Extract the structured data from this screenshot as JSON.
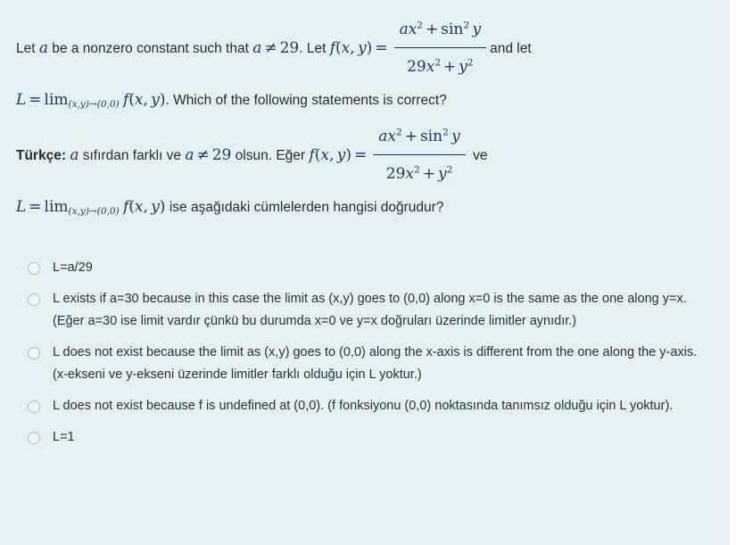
{
  "question": {
    "english": {
      "line1_pre": "Let ",
      "var_a": "a",
      "line1_mid": " be a nonzero constant such that ",
      "cond": "a ≠ 29",
      "line1_mid2": ". Let ",
      "fn": "f(x, y)",
      "eq": "=",
      "numerator": "ax² + sin² y",
      "denominator": "29x² + y²",
      "line1_tail": "and let",
      "line2_L": "L",
      "line2_eq": "=",
      "line2_lim": "lim",
      "line2_limsub": "(x,y)→(0,0)",
      "line2_fn": "f(x, y)",
      "line2_tail": ". Which of the following statements is correct?"
    },
    "turkish": {
      "label": "Türkçe:",
      "line1_pre": " ",
      "var_a": "a",
      "line1_mid": " sıfırdan farklı ve ",
      "cond": "a ≠ 29",
      "line1_mid2": " olsun. Eğer ",
      "fn": "f(x, y)",
      "eq": "=",
      "numerator": "ax² + sin² y",
      "denominator": "29x² + y²",
      "line1_tail": "ve",
      "line2_L": "L",
      "line2_eq": "=",
      "line2_lim": "lim",
      "line2_limsub": "(x,y)→(0,0)",
      "line2_fn": "f(x, y)",
      "line2_tail": " ise aşağıdaki cümlelerden hangisi doğrudur?"
    }
  },
  "options": [
    {
      "id": "option-1",
      "text": "L=a/29",
      "selected": false
    },
    {
      "id": "option-2",
      "text": "L exists if a=30 because in this case the limit as (x,y) goes to (0,0) along x=0 is the same as the one along y=x.  (Eğer a=30 ise limit vardır çünkü bu durumda x=0 ve y=x doğruları üzerinde limitler aynıdır.)",
      "selected": false
    },
    {
      "id": "option-3",
      "text": "L does not exist because the limit as (x,y) goes to (0,0) along the x-axis is different from the one along the y-axis. (x-ekseni ve y-ekseni üzerinde limitler farklı olduğu için L yoktur.)",
      "selected": false
    },
    {
      "id": "option-4",
      "text": "L does not exist because f is undefined at (0,0). (f fonksiyonu (0,0) noktasında tanımsız olduğu için L yoktur).",
      "selected": false
    },
    {
      "id": "option-5",
      "text": "L=1",
      "selected": false
    }
  ],
  "colors": {
    "panel_background": "#e5f0f2",
    "body_text": "#23343c",
    "math_text": "#1f3864",
    "radio_border": "#b5bcbe"
  }
}
